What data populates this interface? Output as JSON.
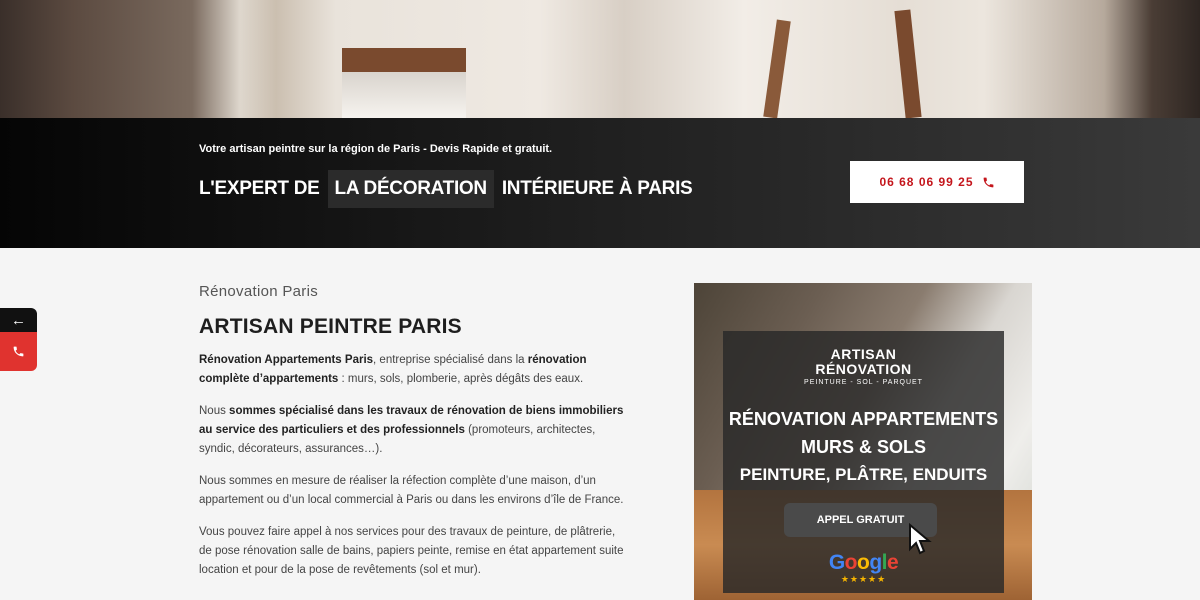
{
  "banner": {
    "tagline": "Votre artisan peintre sur la région de Paris - Devis Rapide et gratuit.",
    "headline_part1": "L'EXPERT DE",
    "headline_highlight": "LA DÉCORATION",
    "headline_part2": "INTÉRIEURE À PARIS",
    "phone_label": "06 68 06 99 25",
    "phone_icon": "phone-icon",
    "accent_color": "#c4161c"
  },
  "side_tabs": {
    "back_label": "←",
    "call_icon": "phone-icon",
    "call_color": "#e0332f"
  },
  "content": {
    "kicker": "Rénovation Paris",
    "title": "ARTISAN PEINTRE PARIS",
    "p1_bold1": "Rénovation Appartements Paris",
    "p1_text1": ", entreprise spécialisé dans la ",
    "p1_bold2": "rénovation complète d’appartements",
    "p1_text2": " : murs, sols, plomberie, après dégâts des eaux.",
    "p2_text1": "Nous ",
    "p2_bold1": "sommes spécialisé dans les travaux de rénovation de biens immobiliers au service des particuliers et des professionnels",
    "p2_text2": " (promoteurs, architectes, syndic, décorateurs, assurances…).",
    "p3": "Nous sommes en mesure de réaliser la réfection complète d’une maison, d’un appartement ou d’un local commercial à Paris ou dans les environs d’île de France.",
    "p4": "Vous pouvez faire appel à nos services pour des travaux de peinture, de plâtrerie, de pose rénovation salle de bains, papiers peinte, remise en état appartement suite location et pour de la pose de revêtements (sol et mur)."
  },
  "promo": {
    "brand_line1": "ARTISAN",
    "brand_line2": "RÉNOVATION",
    "brand_sub": "PEINTURE - SOL - PARQUET",
    "line1": "RÉNOVATION APPARTEMENTS",
    "line2": "MURS & SOLS",
    "line3": "PEINTURE, PLÂTRE, ENDUITS",
    "cta": "APPEL GRATUIT",
    "google_g": "G",
    "google_o1": "o",
    "google_o2": "o",
    "google_g2": "g",
    "google_l": "l",
    "google_e": "e",
    "stars": "★★★★★",
    "rating_stars": 5
  }
}
